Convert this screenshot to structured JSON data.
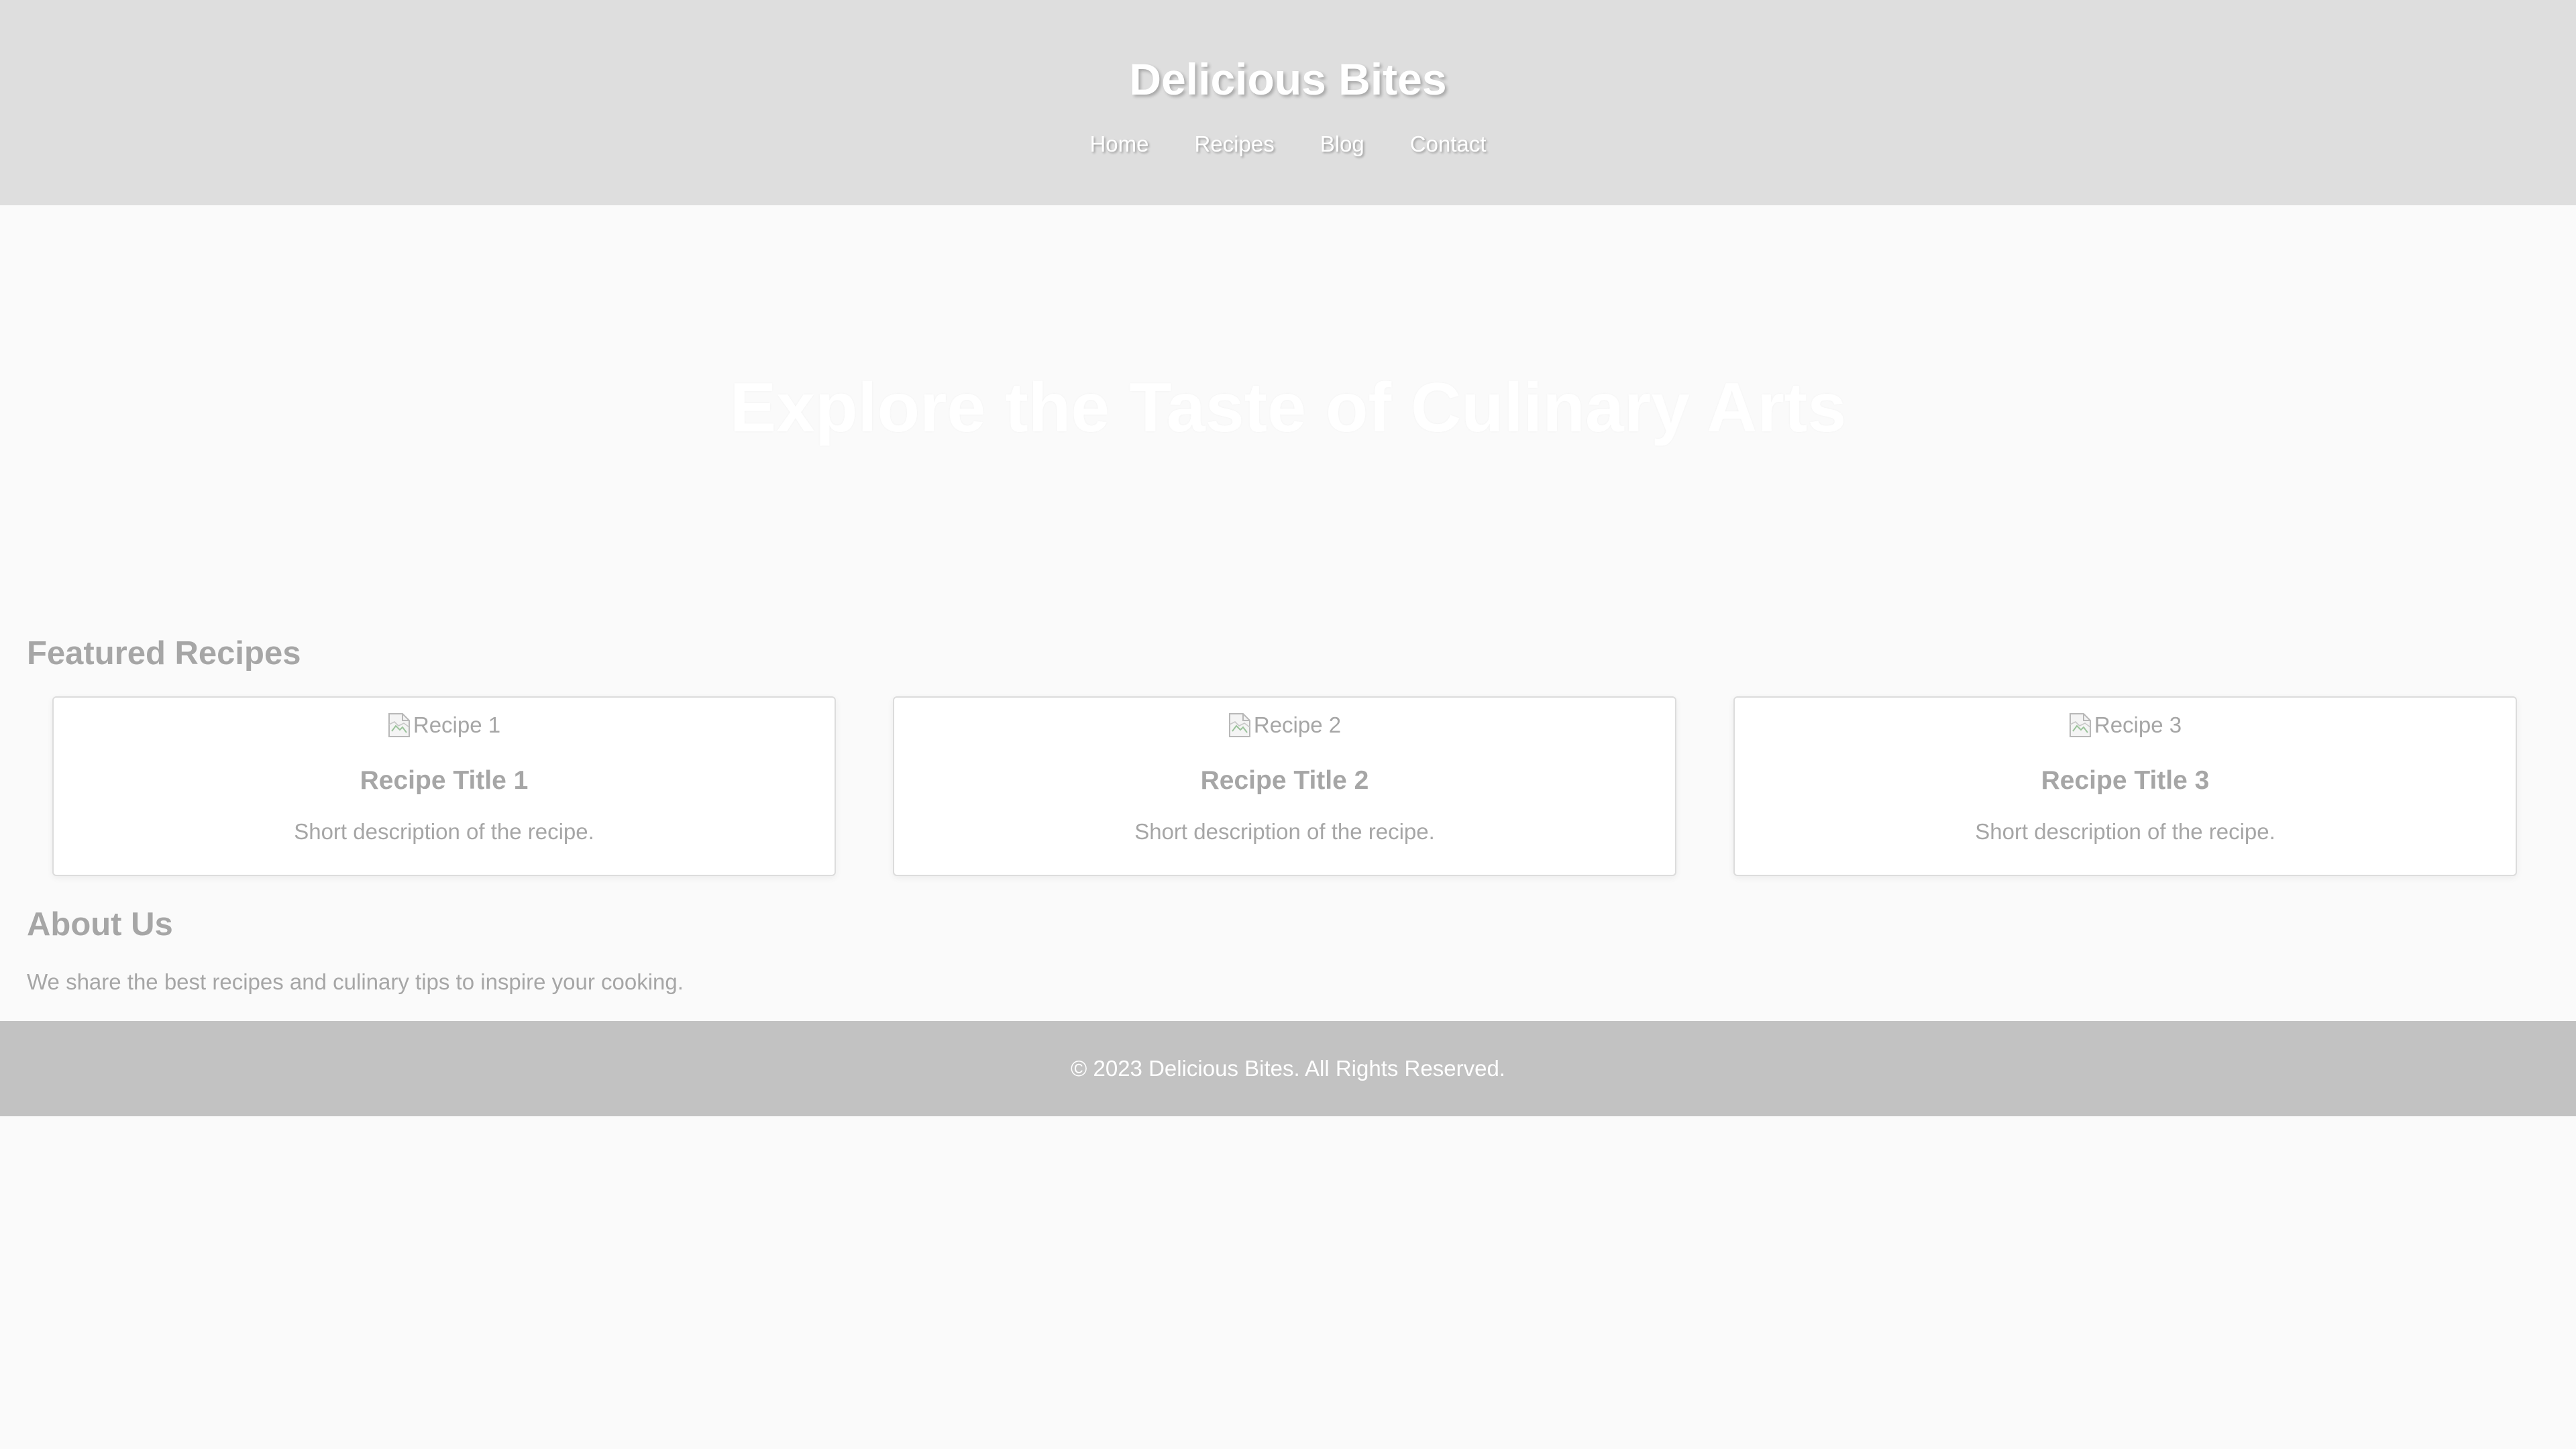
{
  "header": {
    "title": "Delicious Bites",
    "nav": [
      "Home",
      "Recipes",
      "Blog",
      "Contact"
    ]
  },
  "hero": {
    "title": "Explore the Taste of Culinary Arts"
  },
  "featured": {
    "heading": "Featured Recipes",
    "cards": [
      {
        "image_alt": "Recipe 1",
        "title": "Recipe Title 1",
        "description": "Short description of the recipe."
      },
      {
        "image_alt": "Recipe 2",
        "title": "Recipe Title 2",
        "description": "Short description of the recipe."
      },
      {
        "image_alt": "Recipe 3",
        "title": "Recipe Title 3",
        "description": "Short description of the recipe."
      }
    ]
  },
  "about": {
    "heading": "About Us",
    "text": "We share the best recipes and culinary tips to inspire your cooking."
  },
  "footer": {
    "text": "© 2023 Delicious Bites. All Rights Reserved."
  },
  "colors": {
    "header_bg": "#dedede",
    "page_bg": "#fafafa",
    "footer_bg": "#c2c2c2",
    "text_gray": "#a6a6a6",
    "card_bg": "#ffffff"
  }
}
